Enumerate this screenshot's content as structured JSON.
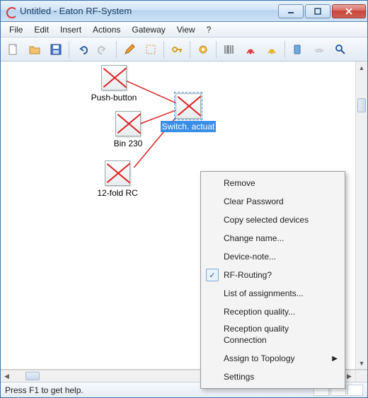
{
  "window": {
    "title": "Untitled - Eaton RF-System"
  },
  "menu": {
    "items": [
      "File",
      "Edit",
      "Insert",
      "Actions",
      "Gateway",
      "View",
      "?"
    ]
  },
  "toolbar_icons": [
    "new-document-icon",
    "open-folder-icon",
    "save-icon",
    "sep",
    "undo-icon",
    "redo-icon",
    "sep",
    "pencil-icon",
    "selection-icon",
    "sep",
    "key-icon",
    "sep",
    "gear-icon",
    "sep",
    "barcode-icon",
    "signal-red-icon",
    "signal-yellow-icon",
    "sep",
    "device-icon",
    "wifi-icon",
    "search-icon"
  ],
  "nodes": {
    "pushbutton": {
      "label": "Push-button"
    },
    "bin230": {
      "label": "Bin 230"
    },
    "rc12": {
      "label": "12-fold RC"
    },
    "switch": {
      "label": "Switch. actuat"
    }
  },
  "context_menu": {
    "items": [
      {
        "label": "Remove",
        "checked": false,
        "submenu": false
      },
      {
        "label": "Clear Password",
        "checked": false,
        "submenu": false
      },
      {
        "label": "Copy selected devices",
        "checked": false,
        "submenu": false
      },
      {
        "label": "Change name...",
        "checked": false,
        "submenu": false
      },
      {
        "label": "Device-note...",
        "checked": false,
        "submenu": false
      },
      {
        "label": "RF-Routing?",
        "checked": true,
        "submenu": false
      },
      {
        "label": "List of assignments...",
        "checked": false,
        "submenu": false
      },
      {
        "label": "Reception quality...",
        "checked": false,
        "submenu": false
      },
      {
        "label": "Reception quality Connection",
        "checked": false,
        "submenu": false
      },
      {
        "label": "Assign to Topology",
        "checked": false,
        "submenu": true
      },
      {
        "label": "Settings",
        "checked": false,
        "submenu": false
      }
    ]
  },
  "statusbar": {
    "message": "Press F1 to get help."
  }
}
